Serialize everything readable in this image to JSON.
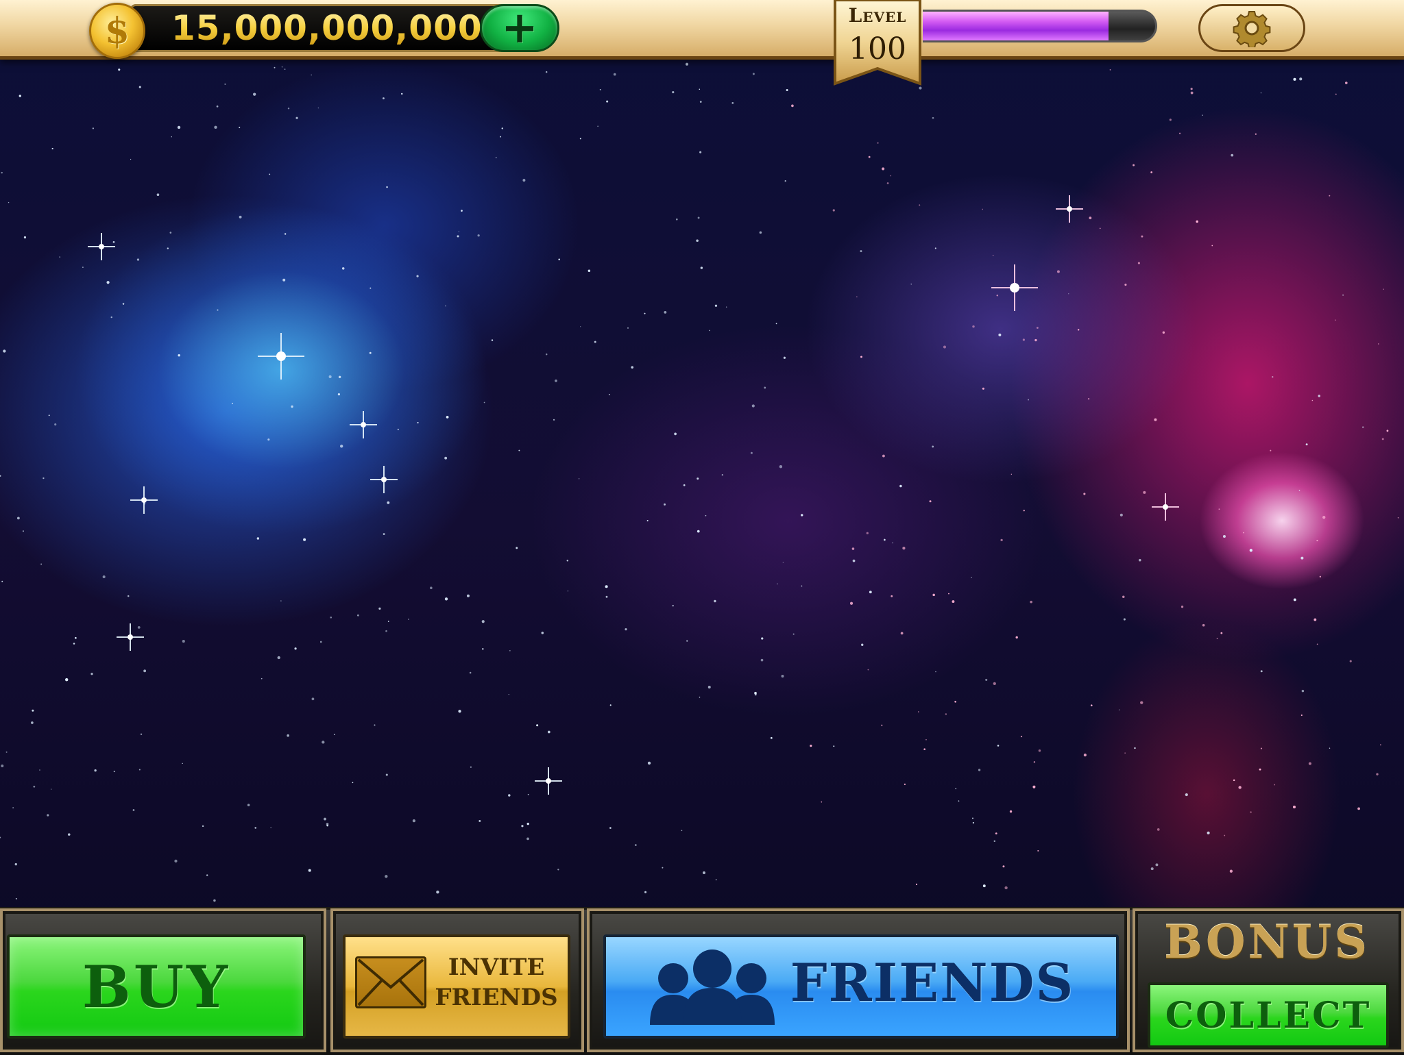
{
  "hud": {
    "coins": "15,000,000,000",
    "coin_symbol": "$",
    "add_symbol": "+",
    "level_label": "Level",
    "level_value": "100",
    "xp_progress_percent": 80
  },
  "bottom_bar": {
    "buy_label": "BUY",
    "invite_label_line1": "INVITE",
    "invite_label_line2": "FRIENDS",
    "friends_label": "FRIENDS",
    "bonus_label": "BONUS",
    "collect_label": "COLLECT"
  },
  "icons": {
    "coin": "dollar-coin-icon",
    "add": "plus-icon",
    "settings": "gear-icon",
    "invite": "envelope-icon",
    "friends": "people-icon"
  },
  "colors": {
    "gold": "#f4c232",
    "buy_green": "#2bd61d",
    "friends_blue": "#2a8cf0",
    "invite_gold": "#e9b73c",
    "xp_purple": "#d25af2"
  }
}
